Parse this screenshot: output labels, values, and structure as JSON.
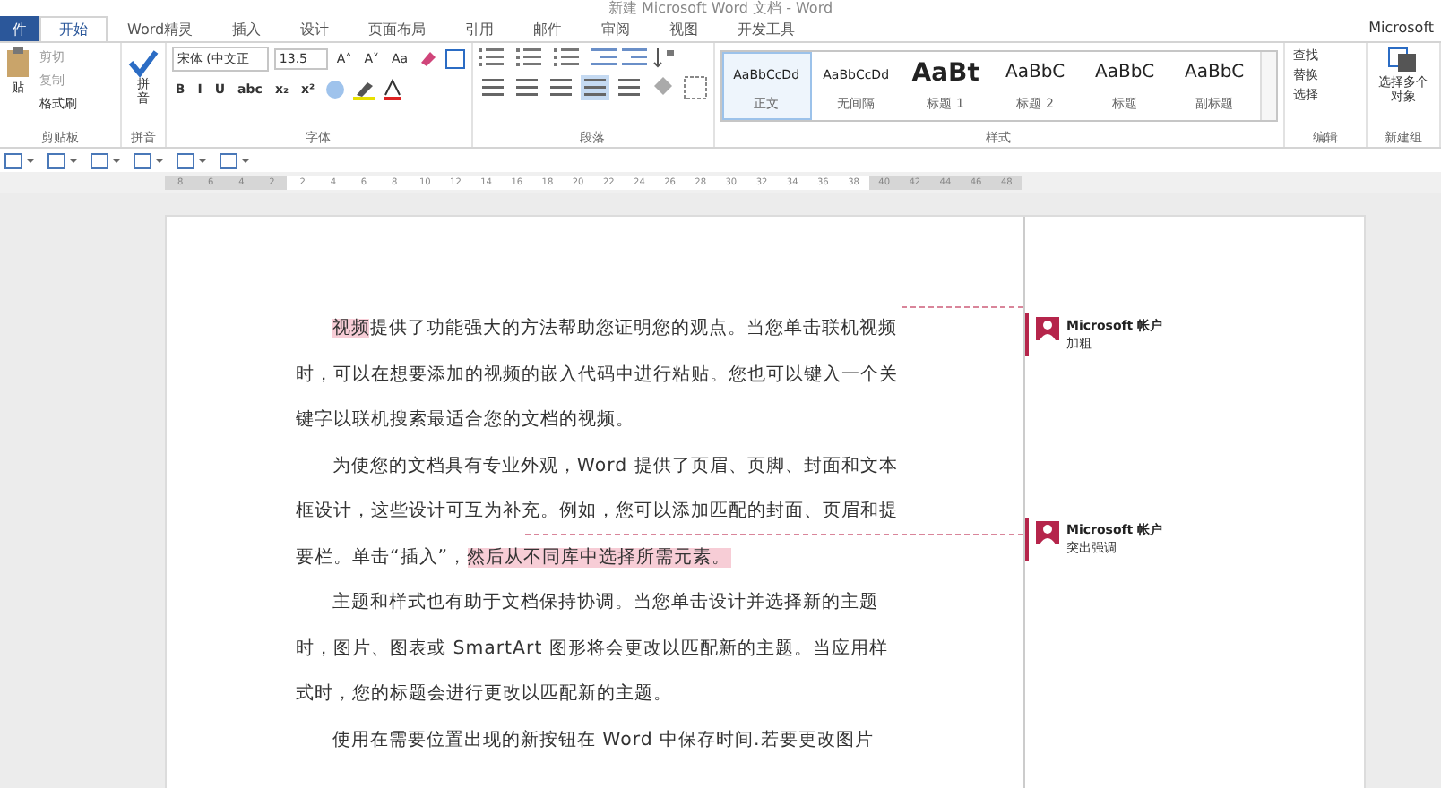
{
  "window": {
    "title": "新建 Microsoft Word 文档 - Word",
    "account": "Microsoft"
  },
  "tabs": [
    {
      "label": "件",
      "selected": false
    },
    {
      "label": "开始",
      "selected": true
    },
    {
      "label": "Word精灵",
      "selected": false
    },
    {
      "label": "插入",
      "selected": false
    },
    {
      "label": "设计",
      "selected": false
    },
    {
      "label": "页面布局",
      "selected": false
    },
    {
      "label": "引用",
      "selected": false
    },
    {
      "label": "邮件",
      "selected": false
    },
    {
      "label": "审阅",
      "selected": false
    },
    {
      "label": "视图",
      "selected": false
    },
    {
      "label": "开发工具",
      "selected": false
    }
  ],
  "clipboard": {
    "paste": "贴",
    "items": [
      "剪切",
      "复制",
      "格式刷"
    ],
    "label": "剪贴板"
  },
  "phonetic": {
    "button": "拼音",
    "label": "拼音"
  },
  "font": {
    "name": "宋体 (中文正",
    "size": "13.5",
    "row1": [
      "A˄",
      "A˅",
      "Aa"
    ],
    "format_buttons": [
      "B",
      "I",
      "U",
      "abc",
      "x₂",
      "x²"
    ],
    "label": "字体"
  },
  "paragraph": {
    "label": "段落"
  },
  "styles": {
    "label": "样式",
    "items": [
      {
        "preview": "AaBbCcDd",
        "name": "正文",
        "kind": "small",
        "selected": true
      },
      {
        "preview": "AaBbCcDd",
        "name": "无间隔",
        "kind": "small",
        "selected": false
      },
      {
        "preview": "AaBt",
        "name": "标题 1",
        "kind": "heading",
        "selected": false
      },
      {
        "preview": "AaBbC",
        "name": "标题 2",
        "kind": "large",
        "selected": false
      },
      {
        "preview": "AaBbC",
        "name": "标题",
        "kind": "large",
        "selected": false
      },
      {
        "preview": "AaBbC",
        "name": "副标题",
        "kind": "large",
        "selected": false
      }
    ]
  },
  "editing": {
    "items": [
      "查找",
      "替换",
      "选择"
    ],
    "label": "编辑"
  },
  "new_group": {
    "button": "选择多个对象",
    "label": "新建组"
  },
  "ruler": [
    {
      "label": "8",
      "shaded": true
    },
    {
      "label": "6",
      "shaded": true
    },
    {
      "label": "4",
      "shaded": true
    },
    {
      "label": "2",
      "shaded": true
    },
    {
      "label": "2",
      "shaded": false
    },
    {
      "label": "4",
      "shaded": false
    },
    {
      "label": "6",
      "shaded": false
    },
    {
      "label": "8",
      "shaded": false
    },
    {
      "label": "10",
      "shaded": false
    },
    {
      "label": "12",
      "shaded": false
    },
    {
      "label": "14",
      "shaded": false
    },
    {
      "label": "16",
      "shaded": false
    },
    {
      "label": "18",
      "shaded": false
    },
    {
      "label": "20",
      "shaded": false
    },
    {
      "label": "22",
      "shaded": false
    },
    {
      "label": "24",
      "shaded": false
    },
    {
      "label": "26",
      "shaded": false
    },
    {
      "label": "28",
      "shaded": false
    },
    {
      "label": "30",
      "shaded": false
    },
    {
      "label": "32",
      "shaded": false
    },
    {
      "label": "34",
      "shaded": false
    },
    {
      "label": "36",
      "shaded": false
    },
    {
      "label": "38",
      "shaded": false
    },
    {
      "label": "40",
      "shaded": true
    },
    {
      "label": "42",
      "shaded": true
    },
    {
      "label": "44",
      "shaded": true
    },
    {
      "label": "46",
      "shaded": true
    },
    {
      "label": "48",
      "shaded": true
    }
  ],
  "document": {
    "paragraphs": [
      [
        {
          "text": "视频",
          "highlighted": true
        },
        {
          "text": "提供了功能强大的方法帮助您证明您的观点。当您单击联机视频时，可以在想要添加的视频的嵌入代码中进行粘贴。您也可以键入一个关键字以联机搜索最适合您的文档的视频。",
          "highlighted": false
        }
      ],
      [
        {
          "text": "为使您的文档具有专业外观，Word 提供了页眉、页脚、封面和文本框设计，这些设计可互为补充。例如，您可以添加匹配的封面、页眉和提要栏。单击“插入”，",
          "highlighted": false
        },
        {
          "text": "然后从不同库中选择所需元素。",
          "highlighted": true
        }
      ],
      [
        {
          "text": "主题和样式也有助于文档保持协调。当您单击设计并选择新的主题时，图片、图表或 SmartArt 图形将会更改以匹配新的主题。当应用样式时，您的标题会进行更改以匹配新的主题。",
          "highlighted": false
        }
      ],
      [
        {
          "text": "使用在需要位置出现的新按钮在 Word 中保存时间.若要更改图片",
          "highlighted": false
        }
      ]
    ]
  },
  "comments": [
    {
      "author": "Microsoft 帐户",
      "text": "加粗"
    },
    {
      "author": "Microsoft 帐户",
      "text": "突出强调"
    }
  ]
}
